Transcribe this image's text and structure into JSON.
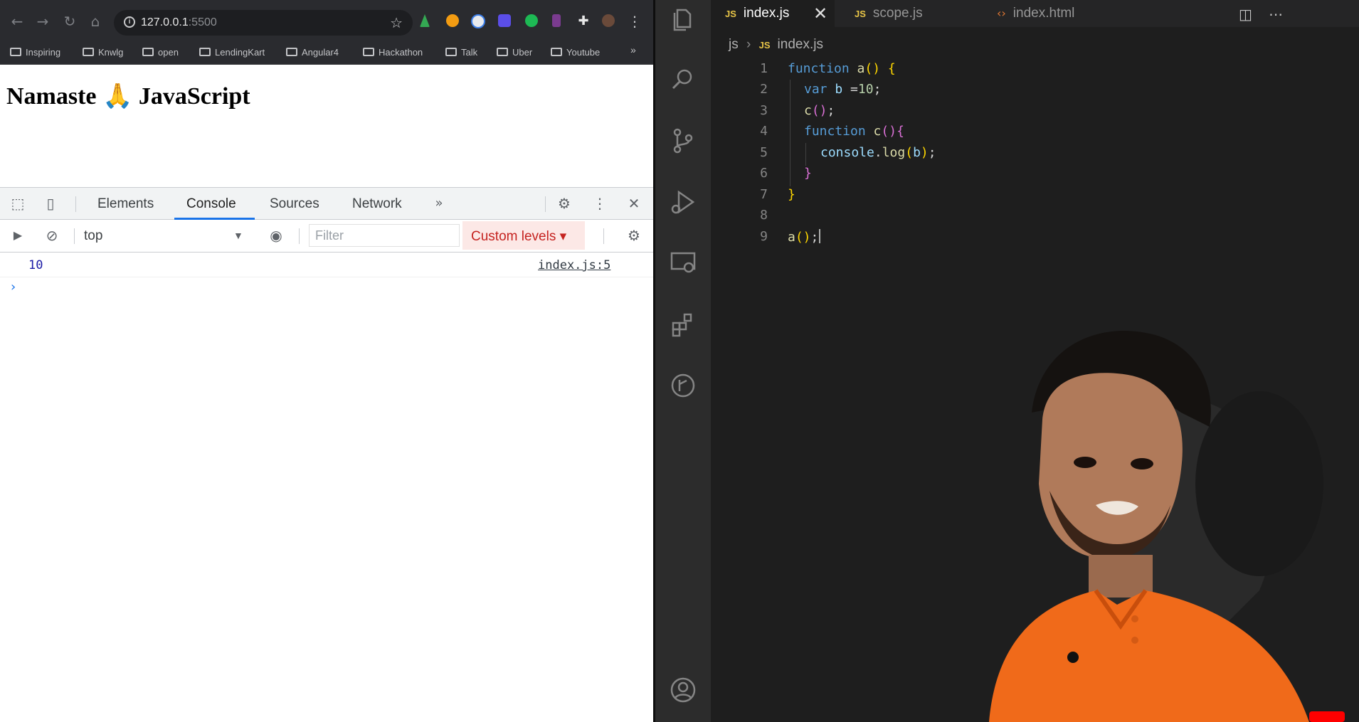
{
  "browser": {
    "address": "127.0.0.1",
    "port": ":5500",
    "bookmarks": [
      "Inspiring",
      "Knwlg",
      "open",
      "LendingKart",
      "Angular4",
      "Hackathon",
      "Talk",
      "Uber",
      "Youtube"
    ],
    "page_heading": "Namaste 🙏 JavaScript"
  },
  "devtools": {
    "tabs": [
      "Elements",
      "Console",
      "Sources",
      "Network"
    ],
    "active_tab": "Console",
    "context": "top",
    "filter_placeholder": "Filter",
    "levels_label": "Custom levels ▾",
    "console": {
      "output_value": "10",
      "output_source": "index.js:5"
    }
  },
  "editor": {
    "tabs": [
      {
        "label": "index.js",
        "type": "js",
        "active": true
      },
      {
        "label": "scope.js",
        "type": "js",
        "active": false
      },
      {
        "label": "index.html",
        "type": "html",
        "active": false
      }
    ],
    "breadcrumb": {
      "folder": "js",
      "file": "index.js"
    },
    "line_numbers": [
      "1",
      "2",
      "3",
      "4",
      "5",
      "6",
      "7",
      "8",
      "9"
    ]
  },
  "colors": {
    "editor_bg": "#1e1e1e",
    "activity_bar": "#2c2c2c",
    "browser_toolbar": "#2a2b2f",
    "devtools_accent": "#1a73e8",
    "levels_bg": "#fce8e6"
  }
}
